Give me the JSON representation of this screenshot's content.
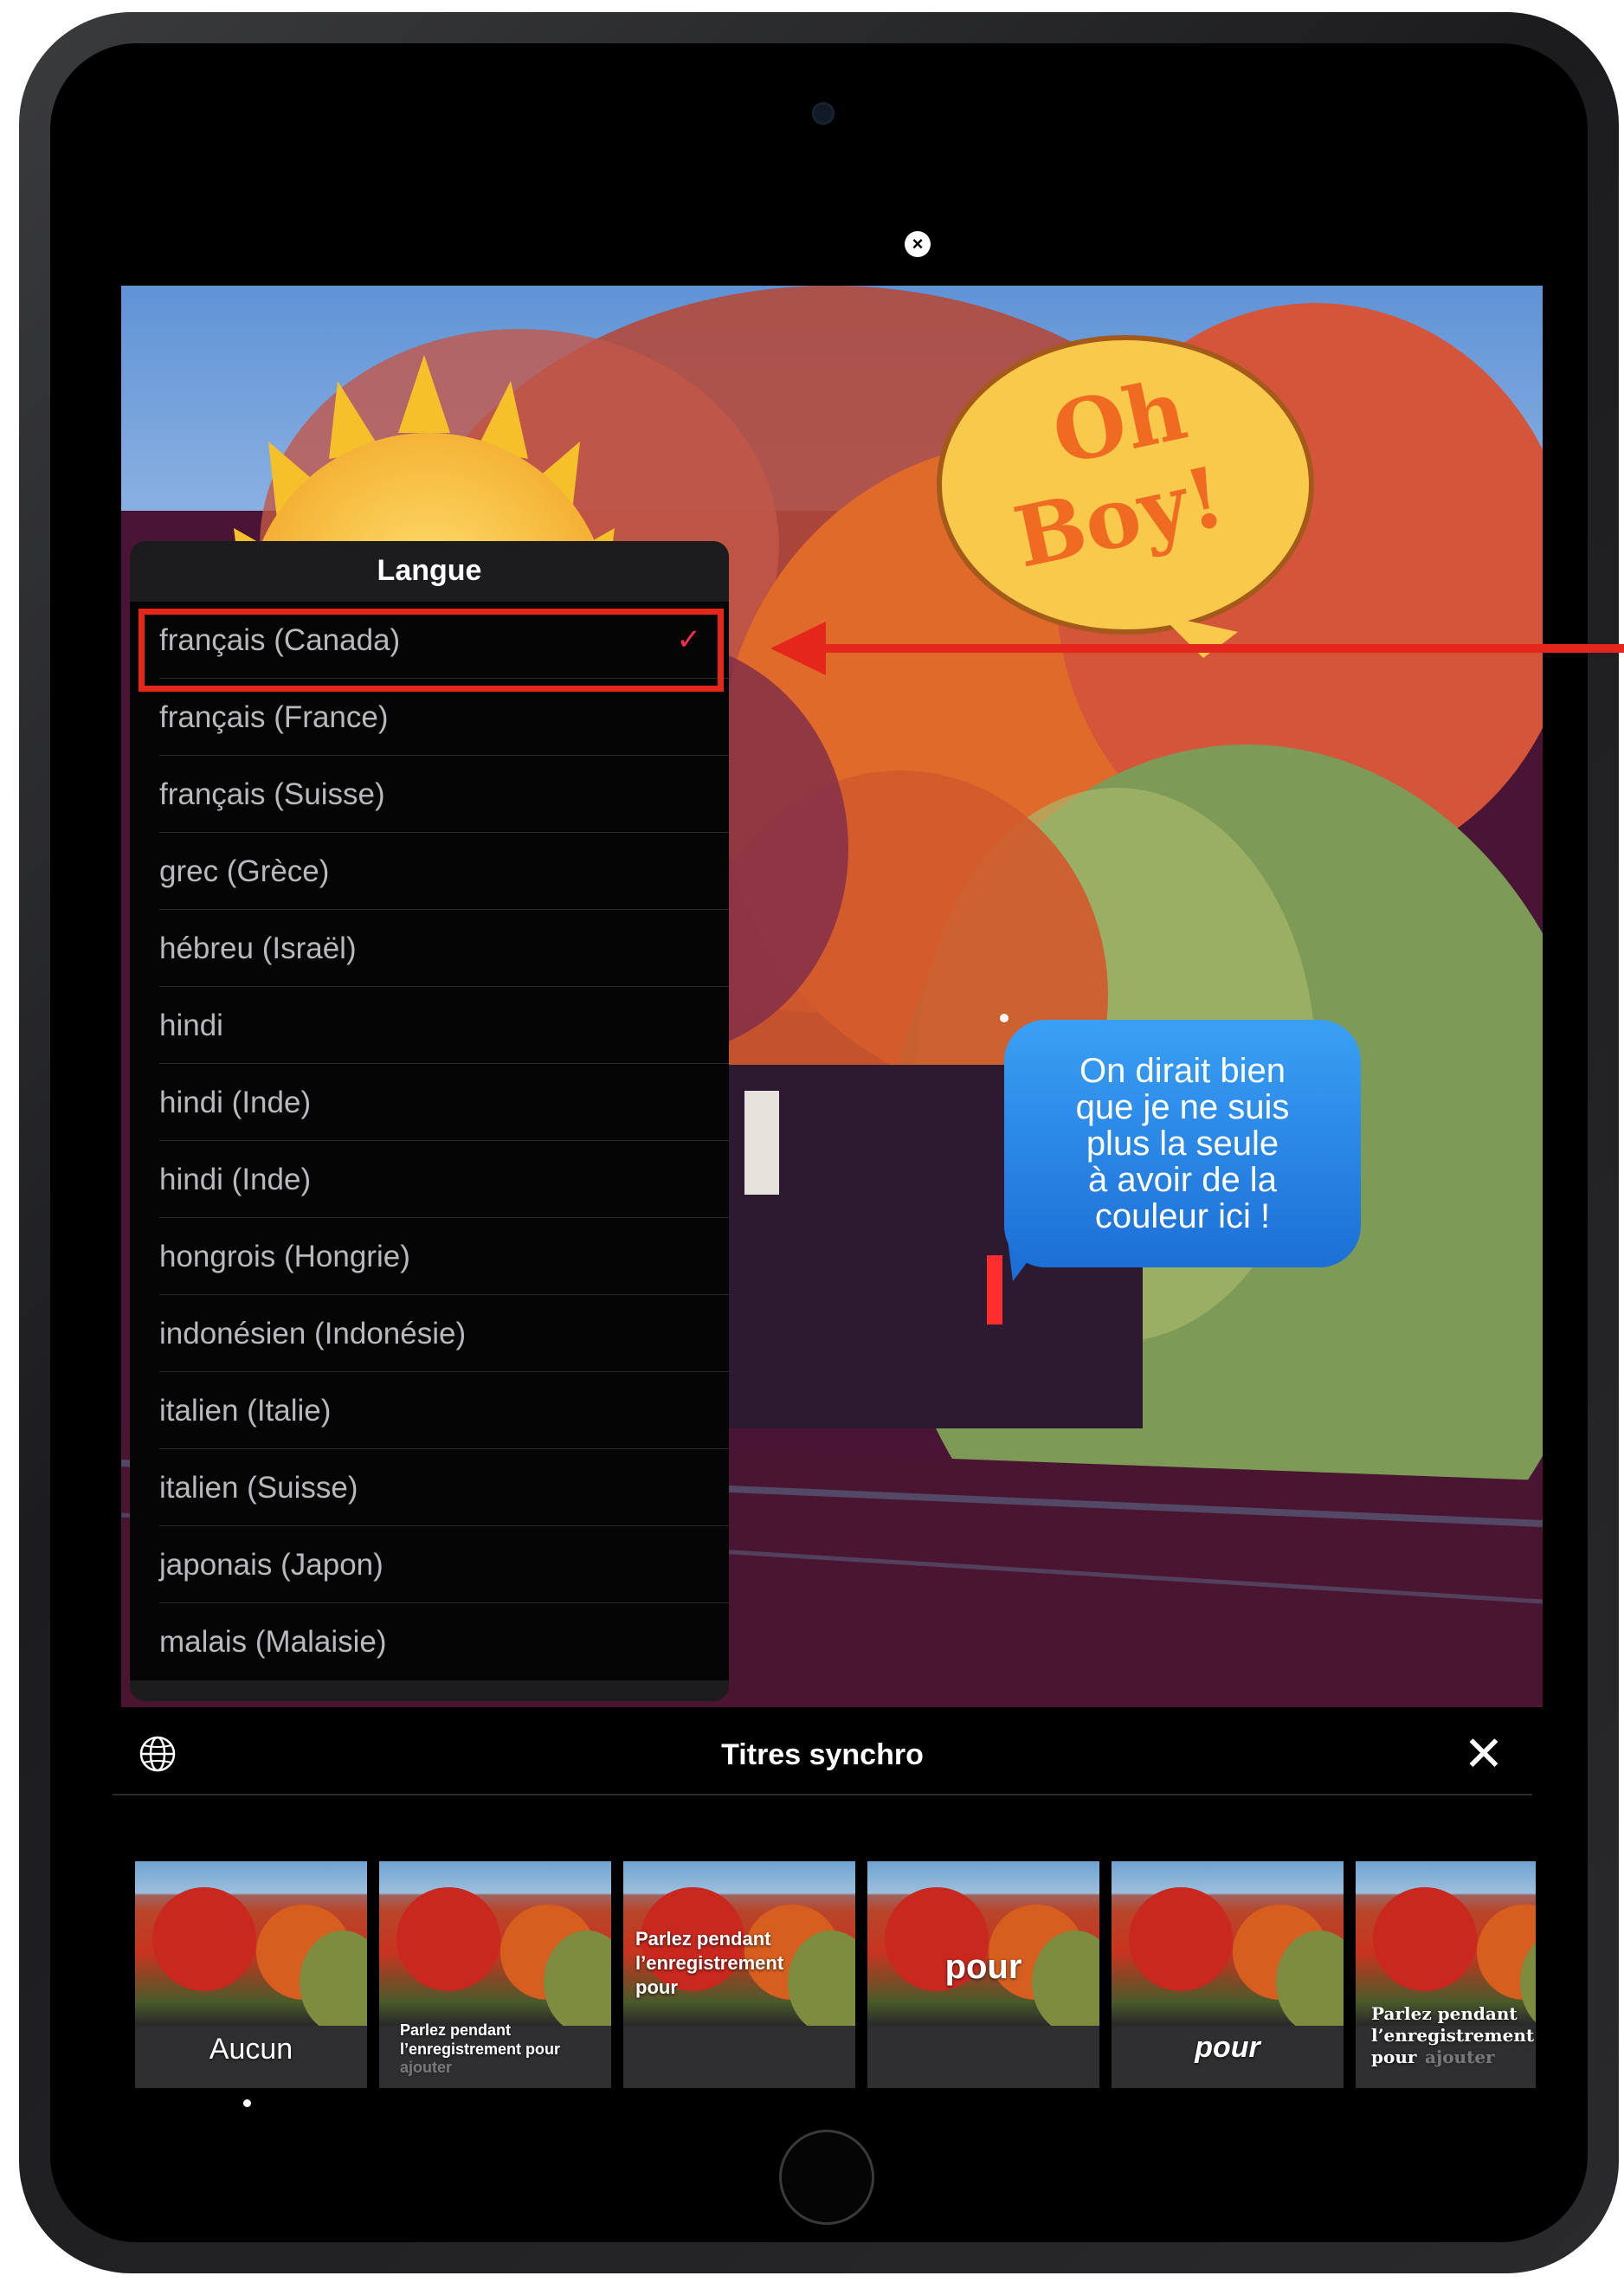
{
  "device": {
    "close_glyph": "×"
  },
  "photo": {
    "sticker_text": "Oh Boy!",
    "speech_bubble": "On dirait bien\nque je ne suis\nplus la seule\nà avoir de la\ncouleur ici !"
  },
  "language_popover": {
    "title": "Langue",
    "items": [
      {
        "label": "français (Canada)",
        "selected": true
      },
      {
        "label": "français (France)"
      },
      {
        "label": "français (Suisse)"
      },
      {
        "label": "grec (Grèce)"
      },
      {
        "label": "hébreu (Israël)"
      },
      {
        "label": "hindi"
      },
      {
        "label": "hindi (Inde)"
      },
      {
        "label": "hindi (Inde)"
      },
      {
        "label": "hongrois (Hongrie)"
      },
      {
        "label": "indonésien (Indonésie)"
      },
      {
        "label": "italien (Italie)"
      },
      {
        "label": "italien (Suisse)"
      },
      {
        "label": "japonais (Japon)"
      },
      {
        "label": "malais (Malaisie)"
      }
    ],
    "check_glyph": "✓"
  },
  "annotation": {
    "highlight_color": "#e4261b"
  },
  "titles_bar": {
    "title": "Titres synchro",
    "close_glyph": "✕"
  },
  "styles": [
    {
      "caption": "Aucun"
    },
    {
      "caption": "Parlez pendant l’enregistrement pour",
      "caption2": "ajouter"
    },
    {
      "caption": "Parlez pendant l’enregistrement pour"
    },
    {
      "caption": "pour"
    },
    {
      "caption": "pour"
    },
    {
      "caption": "Parlez pendant l’enregistrement pour",
      "caption2": "ajouter"
    }
  ]
}
